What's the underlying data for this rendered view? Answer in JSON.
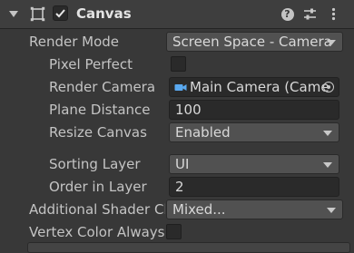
{
  "component": {
    "title": "Canvas",
    "enabled": true,
    "icons": {
      "foldout": "foldout-arrow-icon",
      "component": "canvas-component-icon",
      "help": "help-icon",
      "presets": "presets-icon",
      "menu": "kebab-menu-icon"
    }
  },
  "fields": {
    "render_mode": {
      "label": "Render Mode",
      "value": "Screen Space - Camera"
    },
    "pixel_perfect": {
      "label": "Pixel Perfect",
      "checked": false
    },
    "render_camera": {
      "label": "Render Camera",
      "value": "Main Camera (Came"
    },
    "plane_distance": {
      "label": "Plane Distance",
      "value": "100"
    },
    "resize_canvas": {
      "label": "Resize Canvas",
      "value": "Enabled"
    },
    "sorting_layer": {
      "label": "Sorting Layer",
      "value": "UI"
    },
    "order_in_layer": {
      "label": "Order in Layer",
      "value": "2"
    },
    "additional_shader": {
      "label": "Additional Shader Ch",
      "value": "Mixed..."
    },
    "vertex_color": {
      "label": "Vertex Color Always",
      "checked": false
    }
  },
  "colors": {
    "background": "#383838",
    "header": "#3e3e3e",
    "field_dark": "#2a2a2a",
    "dropdown": "#515151",
    "text": "#c4c4c4",
    "camera_icon_accent": "#5aa9f0"
  }
}
